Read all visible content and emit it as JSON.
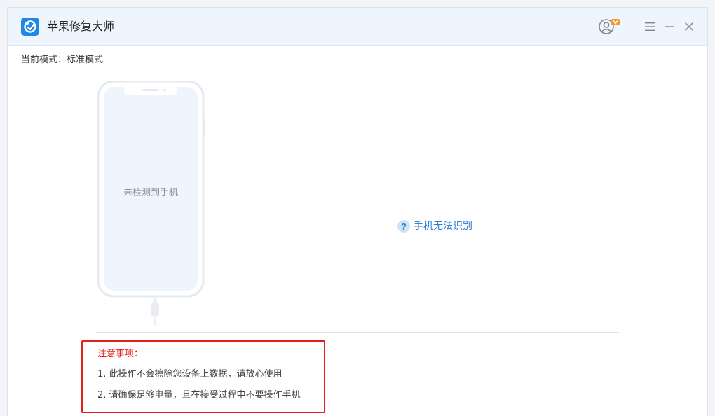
{
  "app": {
    "title": "苹果修复大师",
    "icons": {
      "logo": "app-logo-icon",
      "user": "user-account-icon",
      "menu": "hamburger-menu-icon",
      "minimize": "minimize-icon",
      "close": "close-icon"
    },
    "colors": {
      "accent": "#2d7fd6",
      "badge": "#f39a2b",
      "warning": "#e5201b"
    }
  },
  "mode": {
    "label": "当前模式：标准模式"
  },
  "device": {
    "status": "未检测到手机"
  },
  "help": {
    "label": "手机无法识别",
    "icon": "question-icon"
  },
  "notice": {
    "title": "注意事项：",
    "items": [
      "1. 此操作不会擦除您设备上数据，请放心使用",
      "2. 请确保足够电量，且在接受过程中不要操作手机"
    ]
  }
}
